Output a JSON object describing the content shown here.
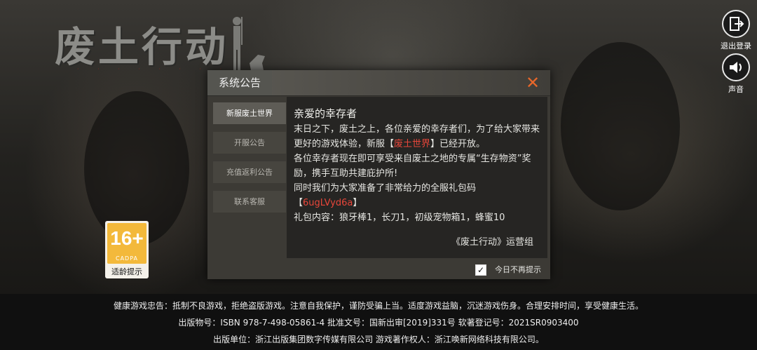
{
  "logo": {
    "title": "废土行动"
  },
  "top_right": {
    "logout_label": "退出登录",
    "sound_label": "声音"
  },
  "age_badge": {
    "age": "16+",
    "org": "CADPA",
    "label": "适龄提示"
  },
  "dialog": {
    "title": "系统公告",
    "tabs": [
      {
        "label": "新服废土世界"
      },
      {
        "label": "开服公告"
      },
      {
        "label": "充值返利公告"
      },
      {
        "label": "联系客服"
      }
    ],
    "greeting": "亲爱的幸存者",
    "para1_a": "末日之下，废土之上，各位亲爱的幸存者们，为了给大家带来更好的游戏体验，新服【",
    "para1_red": "废土世界",
    "para1_b": "】已经开放。",
    "para2": "各位幸存者现在即可享受来自废土之地的专属“生存物资”奖励，携手互助共建庇护所!",
    "para3": "同时我们为大家准备了非常给力的全服礼包码",
    "code_open": "【",
    "code": "6ugLVyd6a",
    "code_close": "】",
    "para4": "礼包内容：狼牙棒1，长刀1，初级宠物箱1，蜂蜜10",
    "signature": "《废土行动》运营组",
    "no_remind": "今日不再提示",
    "no_remind_checked": true
  },
  "footer": {
    "line1": "健康游戏忠告：抵制不良游戏，拒绝盗版游戏。注意自我保护，谨防受骗上当。适度游戏益脑，沉迷游戏伤身。合理安排时间，享受健康生活。",
    "line2": "出版物号：ISBN 978-7-498-05861-4 批准文号：国新出审[2019]331号 软著登记号：2021SR0903400",
    "line3": "出版单位：浙江出版集团数字传媒有限公司  游戏著作权人：浙江唤新网络科技有限公司。"
  }
}
